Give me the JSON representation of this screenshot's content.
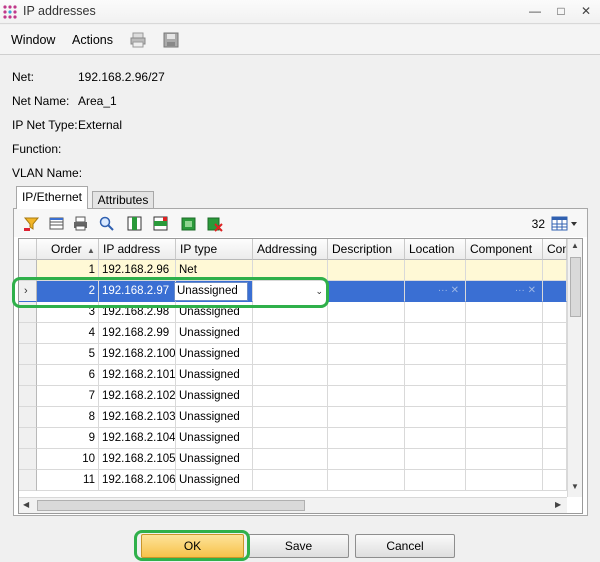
{
  "window": {
    "title": "IP addresses"
  },
  "menu": {
    "window_label": "Window",
    "actions_label": "Actions"
  },
  "fields": {
    "net_label": "Net:",
    "net_value": "192.168.2.96/27",
    "net_name_label": "Net Name:",
    "net_name_value": "Area_1",
    "ip_net_type_label": "IP Net Type:",
    "ip_net_type_value": "External",
    "function_label": "Function:",
    "vlan_name_label": "VLAN Name:"
  },
  "tabs": [
    {
      "label": "IP/Ethernet",
      "active": true
    },
    {
      "label": "Attributes",
      "active": false
    }
  ],
  "grid_toolbar": {
    "count": "32"
  },
  "grid": {
    "columns": [
      "Order",
      "IP address",
      "IP type",
      "Addressing",
      "Description",
      "Location",
      "Component",
      "Com"
    ],
    "rows": [
      {
        "order": "1",
        "ip": "192.168.2.96",
        "type": "Net"
      },
      {
        "order": "2",
        "ip": "192.168.2.97",
        "type": "Unassigned"
      },
      {
        "order": "3",
        "ip": "192.168.2.98",
        "type": "Unassigned"
      },
      {
        "order": "4",
        "ip": "192.168.2.99",
        "type": "Unassigned"
      },
      {
        "order": "5",
        "ip": "192.168.2.100",
        "type": "Unassigned"
      },
      {
        "order": "6",
        "ip": "192.168.2.101",
        "type": "Unassigned"
      },
      {
        "order": "7",
        "ip": "192.168.2.102",
        "type": "Unassigned"
      },
      {
        "order": "8",
        "ip": "192.168.2.103",
        "type": "Unassigned"
      },
      {
        "order": "9",
        "ip": "192.168.2.104",
        "type": "Unassigned"
      },
      {
        "order": "10",
        "ip": "192.168.2.105",
        "type": "Unassigned"
      },
      {
        "order": "11",
        "ip": "192.168.2.106",
        "type": "Unassigned"
      }
    ]
  },
  "buttons": {
    "ok": "OK",
    "save": "Save",
    "cancel": "Cancel"
  },
  "colors": {
    "selection": "#3a6fd3",
    "highlight": "#2fb04a",
    "ok_button": "#f7c24a"
  }
}
